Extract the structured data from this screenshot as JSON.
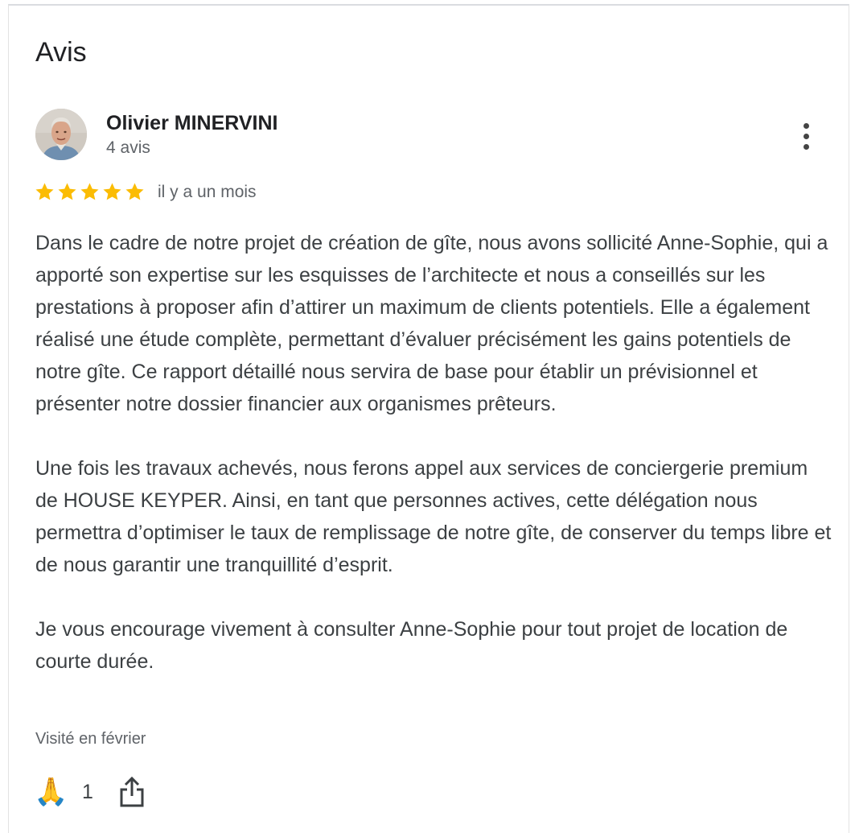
{
  "section": {
    "title": "Avis"
  },
  "review": {
    "author": {
      "name": "Olivier MINERVINI",
      "review_count": "4 avis",
      "avatar_icon": "user-avatar-photo"
    },
    "rating": 5,
    "rating_max": 5,
    "star_color": "#fbbc04",
    "date": "il y a un mois",
    "paragraphs": [
      "Dans le cadre de notre projet de création de gîte, nous avons sollicité Anne-Sophie, qui a apporté son expertise sur les esquisses de l’architecte et nous a conseillés sur les prestations à proposer afin d’attirer un maximum de clients potentiels. Elle a également réalisé une étude complète, permettant d’évaluer précisément les gains potentiels de notre gîte. Ce rapport détaillé nous servira de base pour établir un prévisionnel et présenter notre dossier financier aux organismes prêteurs.",
      "Une fois les travaux achevés, nous ferons appel aux services de conciergerie premium de HOUSE KEYPER. Ainsi, en tant que personnes actives, cette délégation nous permettra d’optimiser le taux de remplissage de notre gîte, de conserver du temps libre et de nous garantir une tranquillité d’esprit.",
      "Je vous encourage vivement à consulter Anne-Sophie pour tout projet de location de courte durée."
    ],
    "visited": "Visité en février",
    "reactions": {
      "emoji": "🙏",
      "emoji_name": "folded-hands-icon",
      "count": "1"
    },
    "actions": {
      "more_icon": "more-vertical-icon",
      "share_icon": "share-icon"
    }
  }
}
